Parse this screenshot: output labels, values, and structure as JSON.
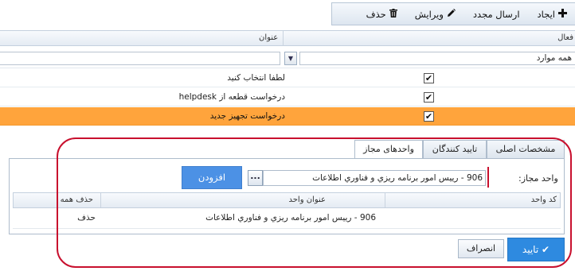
{
  "toolbar": {
    "create_label": "ایجاد",
    "create_icon": "plus-icon",
    "resend_label": "ارسال مجدد",
    "edit_label": "ویرایش",
    "edit_icon": "pencil-icon",
    "delete_label": "حذف",
    "delete_icon": "trash-icon"
  },
  "grid": {
    "columns": {
      "active": "فعال",
      "title": "عنوان"
    },
    "filter_all": "همه موارد",
    "rows": [
      {
        "title": "لطفا انتخاب کنید",
        "checked": true,
        "selected": false
      },
      {
        "title": "درخواست قطعه از helpdesk",
        "checked": true,
        "selected": false
      },
      {
        "title": "درخواست تجهیز جدید",
        "checked": true,
        "selected": true
      }
    ]
  },
  "tabs": [
    {
      "label": "مشخصات اصلی",
      "active": false
    },
    {
      "label": "تایید کنندگان",
      "active": false
    },
    {
      "label": "واحدهای مجاز",
      "active": true
    }
  ],
  "form": {
    "unit_label": "واحد مجاز:",
    "unit_value": "906 - رييس امور برنامه ريزي و فناوري اطلاعات",
    "browse_label": "...",
    "add_label": "افزودن"
  },
  "units_table": {
    "columns": {
      "code": "کد واحد",
      "title": "عنوان واحد",
      "delete_all": "حذف همه"
    },
    "rows": [
      {
        "code": "",
        "title": "906 - رييس امور برنامه ريزي و فناوري اطلاعات",
        "delete": "حذف"
      }
    ]
  },
  "actions": {
    "confirm_label": "تایید",
    "cancel_label": "انصراف"
  },
  "colors": {
    "selected_row": "#ffa43c",
    "primary_button": "#2e8ae0",
    "add_button": "#4c91e5",
    "annotation": "#c8102e"
  }
}
